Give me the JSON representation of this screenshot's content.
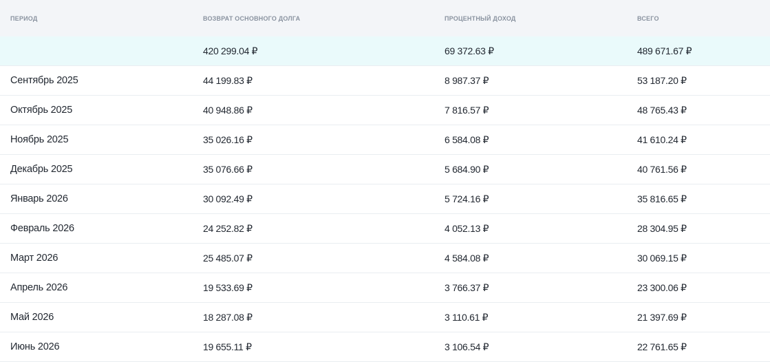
{
  "header": {
    "period": "ПЕРИОД",
    "principal": "ВОЗВРАТ ОСНОВНОГО ДОЛГА",
    "interest": "ПРОЦЕНТНЫЙ ДОХОД",
    "total": "ВСЕГО"
  },
  "summary": {
    "period": "",
    "principal": "420 299.04 ₽",
    "interest": "69 372.63 ₽",
    "total": "489 671.67 ₽"
  },
  "rows": [
    {
      "period": "Сентябрь 2025",
      "principal": "44 199.83 ₽",
      "interest": "8 987.37 ₽",
      "total": "53 187.20 ₽"
    },
    {
      "period": "Октябрь 2025",
      "principal": "40 948.86 ₽",
      "interest": "7 816.57 ₽",
      "total": "48 765.43 ₽"
    },
    {
      "period": "Ноябрь 2025",
      "principal": "35 026.16 ₽",
      "interest": "6 584.08 ₽",
      "total": "41 610.24 ₽"
    },
    {
      "period": "Декабрь 2025",
      "principal": "35 076.66 ₽",
      "interest": "5 684.90 ₽",
      "total": "40 761.56 ₽"
    },
    {
      "period": "Январь 2026",
      "principal": "30 092.49 ₽",
      "interest": "5 724.16 ₽",
      "total": "35 816.65 ₽"
    },
    {
      "period": "Февраль 2026",
      "principal": "24 252.82 ₽",
      "interest": "4 052.13 ₽",
      "total": "28 304.95 ₽"
    },
    {
      "period": "Март 2026",
      "principal": "25 485.07 ₽",
      "interest": "4 584.08 ₽",
      "total": "30 069.15 ₽"
    },
    {
      "period": "Апрель 2026",
      "principal": "19 533.69 ₽",
      "interest": "3 766.37 ₽",
      "total": "23 300.06 ₽"
    },
    {
      "period": "Май 2026",
      "principal": "18 287.08 ₽",
      "interest": "3 110.61 ₽",
      "total": "21 397.69 ₽"
    },
    {
      "period": "Июнь 2026",
      "principal": "19 655.11 ₽",
      "interest": "3 106.54 ₽",
      "total": "22 761.65 ₽"
    }
  ]
}
